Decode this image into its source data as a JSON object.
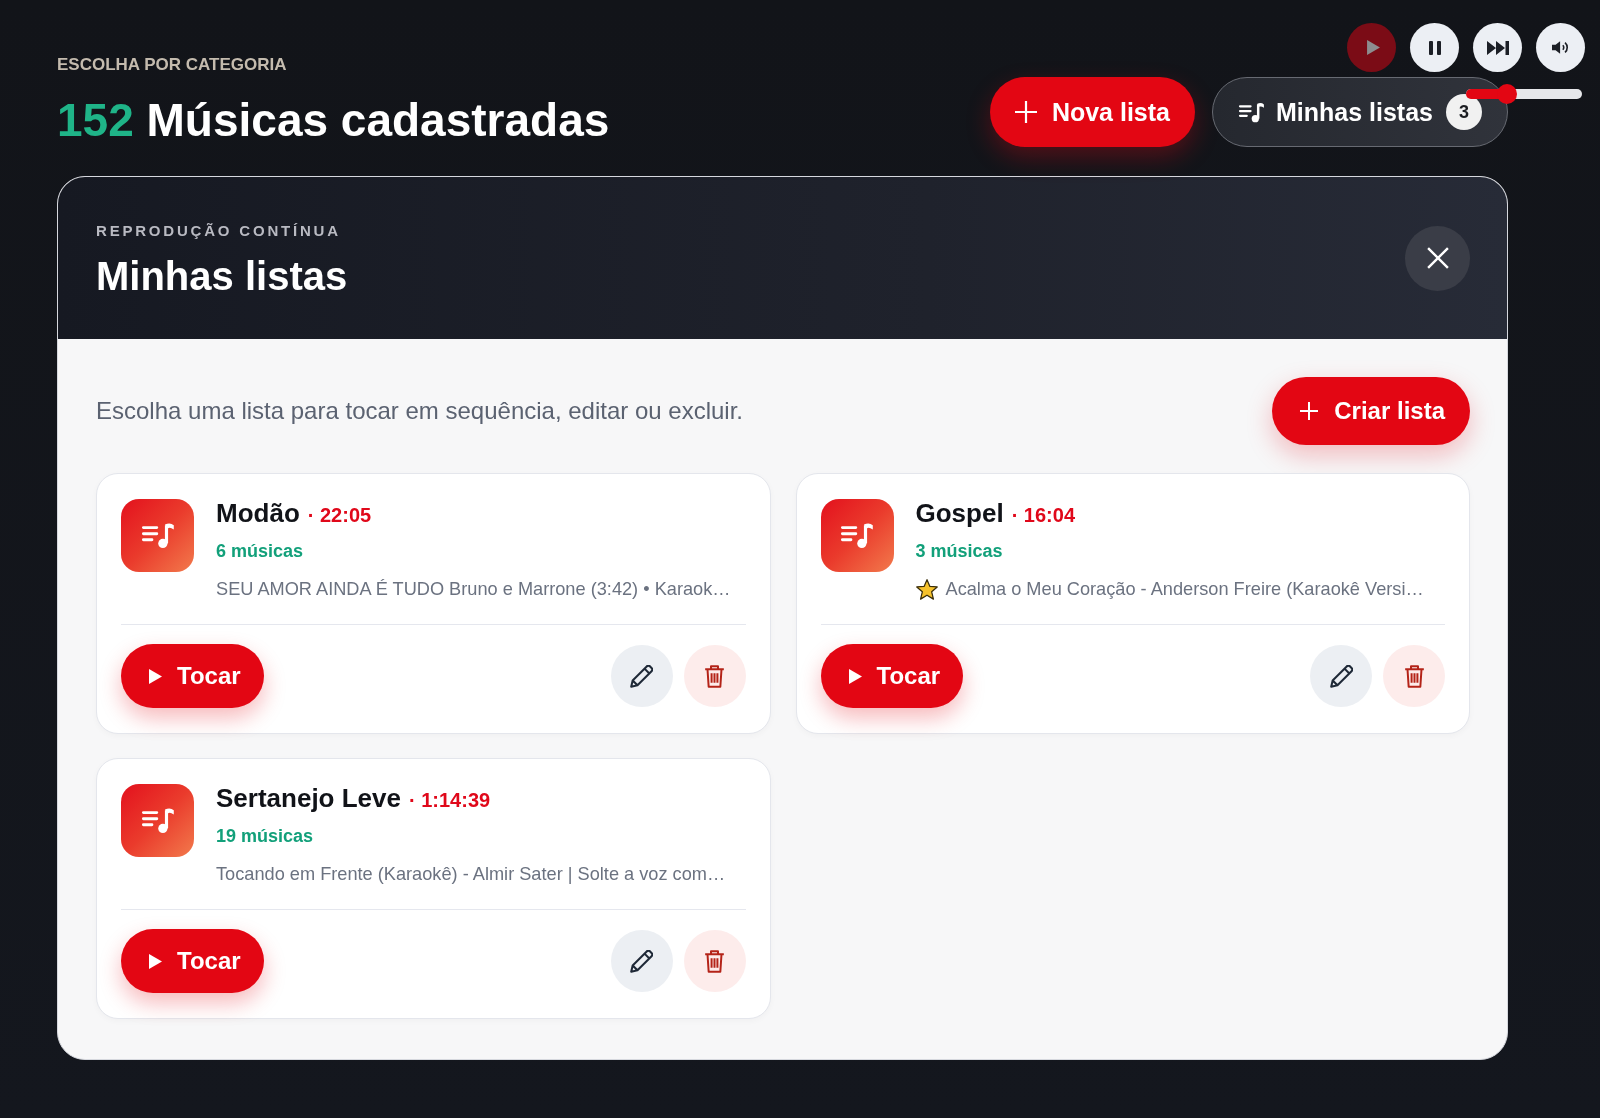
{
  "header": {
    "eyebrow": "ESCOLHA POR CATEGORIA",
    "count": "152",
    "title": "Músicas cadastradas"
  },
  "actions": {
    "new_list": "Nova lista",
    "my_lists": {
      "label": "Minhas listas",
      "badge": "3"
    }
  },
  "player": {
    "buttons": [
      {
        "kind": "play",
        "disabled": true
      },
      {
        "kind": "pause",
        "disabled": false
      },
      {
        "kind": "next",
        "disabled": false
      },
      {
        "kind": "volume",
        "disabled": false
      }
    ],
    "volume": {
      "level": 0.35
    }
  },
  "modal": {
    "eyebrow": "REPRODUÇÃO CONTÍNUA",
    "title": "Minhas listas",
    "description": "Escolha uma lista para tocar em sequência, editar ou excluir.",
    "create_button": "Criar lista",
    "playlists": [
      {
        "name": "Modão",
        "duration": "· 22:05",
        "count": "6 músicas",
        "starred": false,
        "preview": "SEU AMOR AINDA É TUDO Bruno e Marrone (3:42) • Karaok…",
        "play_button": "Tocar"
      },
      {
        "name": "Gospel",
        "duration": "· 16:04",
        "count": "3 músicas",
        "starred": true,
        "preview": "Acalma o Meu Coração - Anderson Freire (Karaokê Versi…",
        "play_button": "Tocar"
      },
      {
        "name": "Sertanejo Leve",
        "duration": "· 1:14:39",
        "count": "19 músicas",
        "starred": false,
        "preview": "Tocando em Frente (Karaokê) - Almir Sater | Solte a voz com…",
        "play_button": "Tocar"
      }
    ]
  }
}
